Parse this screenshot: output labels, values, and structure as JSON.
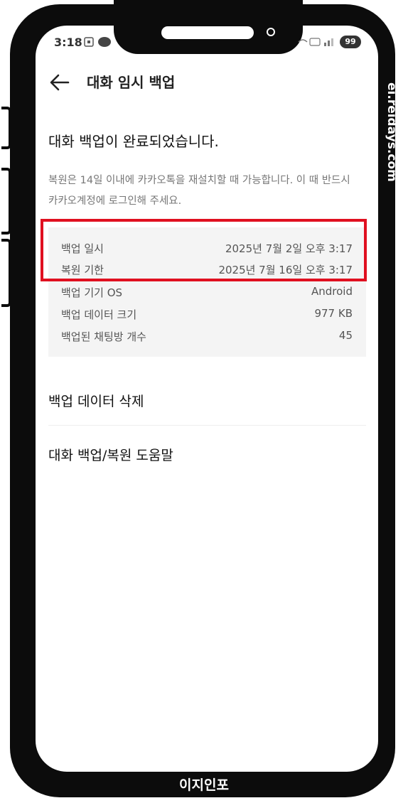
{
  "status_bar": {
    "time": "3:18",
    "battery": "99"
  },
  "app_bar": {
    "title": "대화 임시 백업"
  },
  "heading": "대화 백업이 완료되었습니다.",
  "description": "복원은 14일 이내에 카카오톡을 재설치할 때 가능합니다. 이 때 반드시 카카오계정에 로그인해 주세요.",
  "info": [
    {
      "label": "백업 일시",
      "value": "2025년 7월 2일 오후 3:17"
    },
    {
      "label": "복원 기한",
      "value": "2025년 7월 16일 오후 3:17"
    },
    {
      "label": "백업 기기 OS",
      "value": "Android"
    },
    {
      "label": "백업 데이터 크기",
      "value": "977 KB"
    },
    {
      "label": "백업된 채팅방 개수",
      "value": "45"
    }
  ],
  "menu": {
    "delete": "백업 데이터 삭제",
    "help": "대화 백업/복원 도움말"
  },
  "watermark": "ei.reidays.com",
  "bottom_label": "이지인포",
  "colors": {
    "highlight": "#e01020",
    "info_bg": "#f4f4f4"
  }
}
